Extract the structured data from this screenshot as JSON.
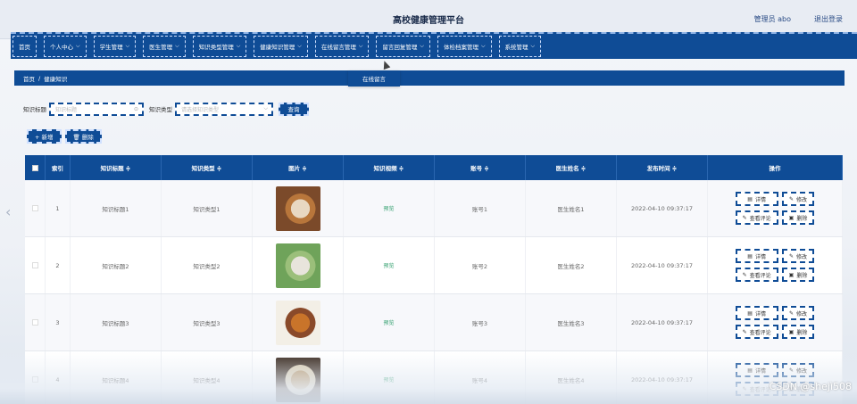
{
  "header": {
    "title": "高校健康管理平台",
    "user": "管理员 abo",
    "logout": "退出登录"
  },
  "nav": [
    {
      "label": "首页",
      "chev": ""
    },
    {
      "label": "个人中心",
      "chev": "⌵"
    },
    {
      "label": "学生管理",
      "chev": "⌵"
    },
    {
      "label": "医生管理",
      "chev": "⌵"
    },
    {
      "label": "知识类型管理",
      "chev": "⌵"
    },
    {
      "label": "健康知识管理",
      "chev": "⌵"
    },
    {
      "label": "在线留言管理",
      "chev": "⌵"
    },
    {
      "label": "留言回复管理",
      "chev": "⌵"
    },
    {
      "label": "体检档案管理",
      "chev": "⌵"
    },
    {
      "label": "系统管理",
      "chev": "⌵"
    }
  ],
  "dropdown": {
    "item": "在线留言"
  },
  "breadcrumb": {
    "home": "首页",
    "sep": "/",
    "current": "健康知识"
  },
  "search": {
    "title_label": "知识标题",
    "title_placeholder": "知识标题",
    "type_label": "知识类型",
    "type_placeholder": "请选择知识类型",
    "query": "查询",
    "clear_glyph": "⊙"
  },
  "actions": {
    "add": "+ 新增",
    "delete": "🗑 删除"
  },
  "columns": [
    "索引",
    "知识标题 ≑",
    "知识类型 ≑",
    "图片 ≑",
    "知识视频 ≑",
    "账号 ≑",
    "医生姓名 ≑",
    "发布时间 ≑",
    "操作"
  ],
  "rows": [
    {
      "idx": "1",
      "title": "知识标题1",
      "type": "知识类型1",
      "video": "预览",
      "account": "账号1",
      "doctor": "医生姓名1",
      "time": "2022-04-10 09:37:17",
      "thumb_colors": [
        "#7b4a2a",
        "#e8d8c2",
        "#b8763b"
      ]
    },
    {
      "idx": "2",
      "title": "知识标题2",
      "type": "知识类型2",
      "video": "预览",
      "account": "账号2",
      "doctor": "医生姓名2",
      "time": "2022-04-10 09:37:17",
      "thumb_colors": [
        "#6fa35a",
        "#e8e4dc",
        "#9bbf7a"
      ]
    },
    {
      "idx": "3",
      "title": "知识标题3",
      "type": "知识类型3",
      "video": "预览",
      "account": "账号3",
      "doctor": "医生姓名3",
      "time": "2022-04-10 09:37:17",
      "thumb_colors": [
        "#f3efe6",
        "#c9742a",
        "#8a4a2a"
      ]
    },
    {
      "idx": "4",
      "title": "知识标题4",
      "type": "知识类型4",
      "video": "预览",
      "account": "账号4",
      "doctor": "医生姓名4",
      "time": "2022-04-10 09:37:17",
      "thumb_colors": [
        "#3a2a1f",
        "#b89a70",
        "#d8cbb0"
      ]
    }
  ],
  "ops": {
    "detail": "详情",
    "edit": "修改",
    "comments": "查看评论",
    "remove": "删除"
  },
  "watermark": "CSDN @shejì508",
  "colors": {
    "primary": "#0f4c96",
    "preview": "#2e9e6b"
  }
}
